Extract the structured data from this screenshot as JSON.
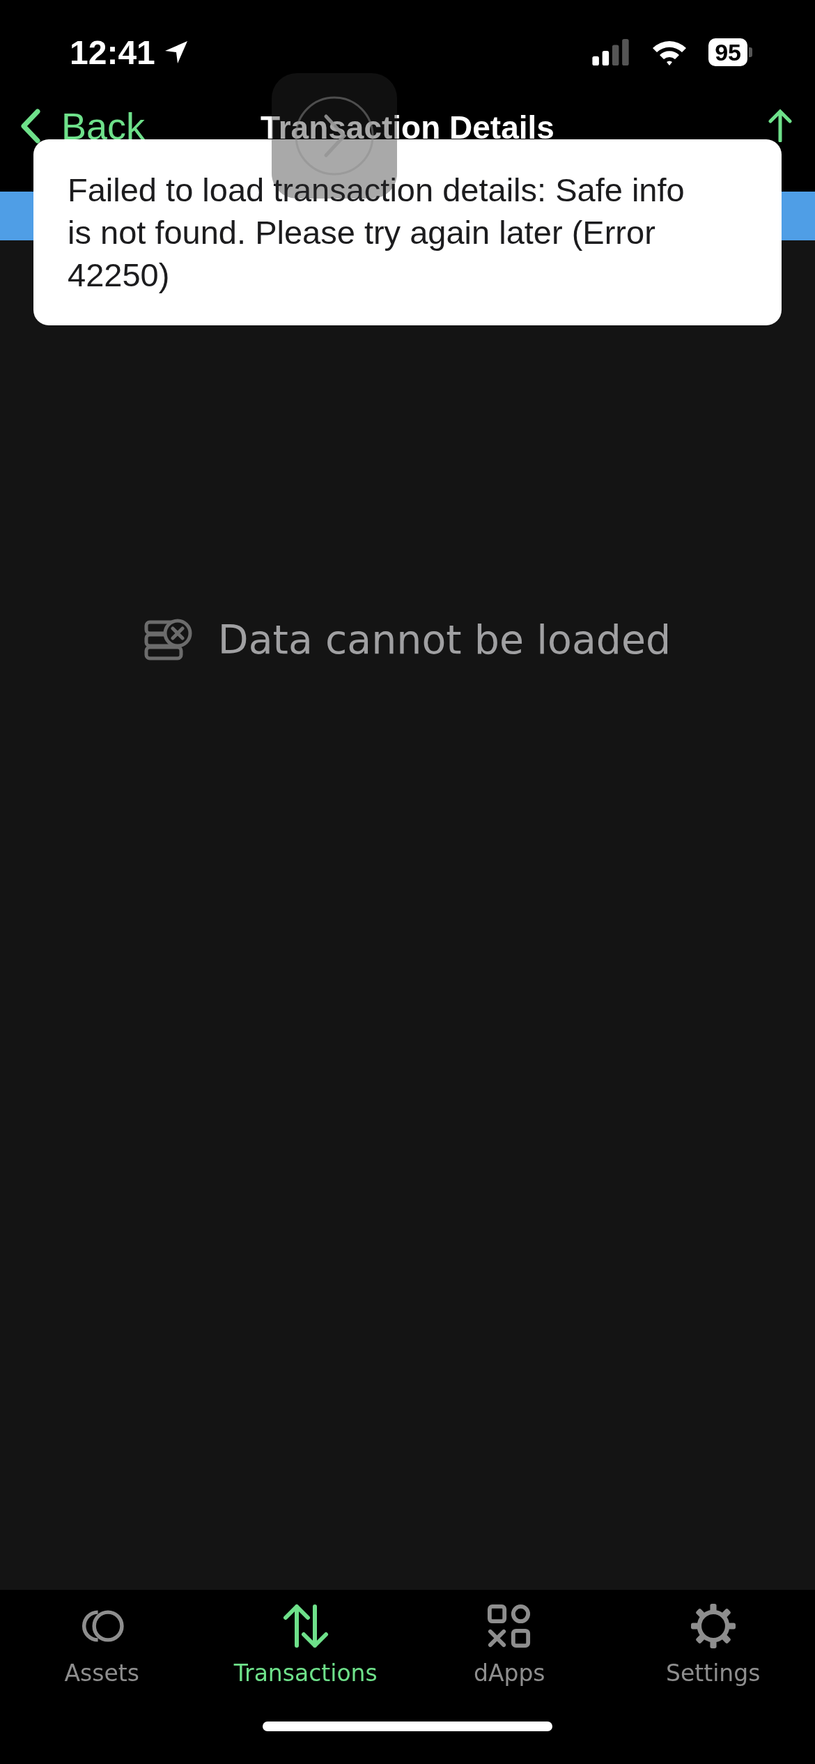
{
  "status_bar": {
    "time": "12:41",
    "battery": "95"
  },
  "nav": {
    "back": "Back",
    "title": "Transaction Details"
  },
  "toast": {
    "message": "Failed to load transaction details: Safe info is not found. Please try again later (Error 42250)"
  },
  "empty_state": {
    "message": "Data cannot be loaded"
  },
  "tabs": [
    {
      "label": "Assets",
      "kind": "assets",
      "selected": false
    },
    {
      "label": "Transactions",
      "kind": "transactions",
      "selected": true
    },
    {
      "label": "dApps",
      "kind": "dapps",
      "selected": false
    },
    {
      "label": "Settings",
      "kind": "settings",
      "selected": false
    }
  ]
}
